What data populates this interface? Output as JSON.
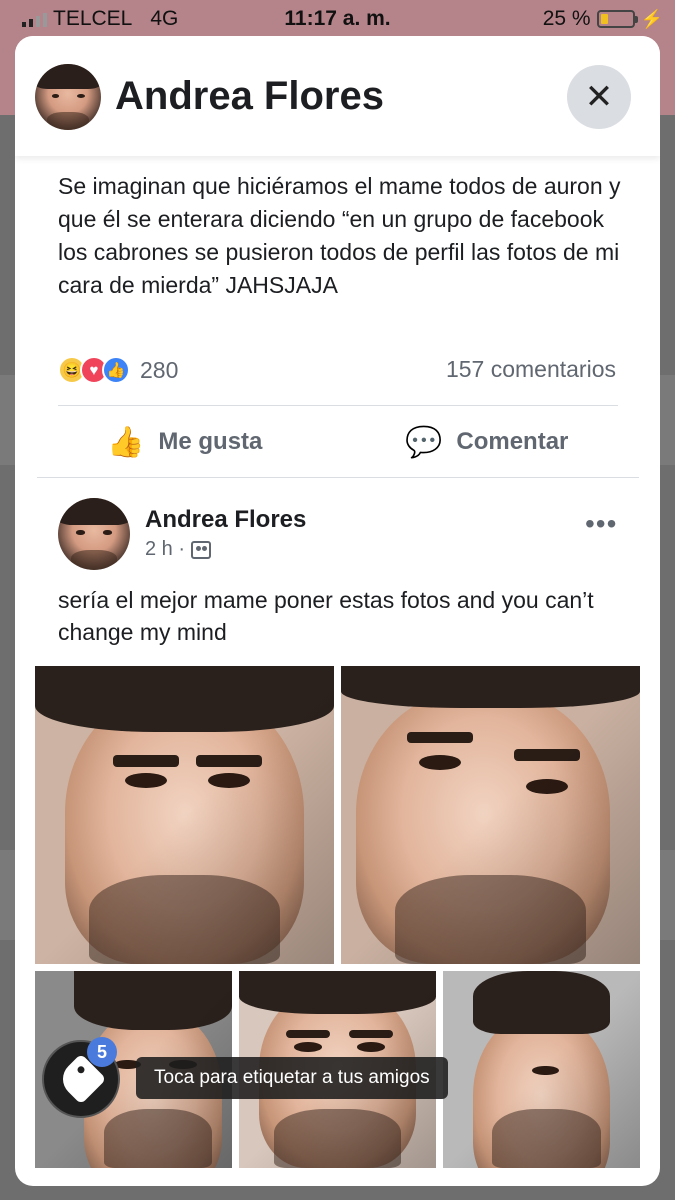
{
  "status_bar": {
    "carrier": "TELCEL",
    "network": "4G",
    "time": "11:17 a. m.",
    "battery_percent": "25 %",
    "battery_level": 0.25
  },
  "header": {
    "name": "Andrea Flores",
    "close_icon": "close-icon"
  },
  "post1": {
    "text": "Se imaginan que hiciéramos el mame todos de auron y que él se enterara diciendo “en un grupo de facebook los cabrones se pusieron todos de perfil las fotos de mi cara de mierda” JAHSJAJA",
    "reactions": {
      "icons": [
        "haha-icon",
        "love-icon",
        "like-icon"
      ],
      "count": "280"
    },
    "comments": "157 comentarios",
    "actions": {
      "like_label": "Me gusta",
      "comment_label": "Comentar"
    }
  },
  "post2": {
    "author": "Andrea Flores",
    "time": "2 h ·",
    "more": "•••",
    "text": "sería el mejor mame poner estas fotos and you can’t change my mind",
    "photo_count": 5
  },
  "tagging": {
    "badge": "5",
    "tooltip": "Toca para etiquetar a tus amigos"
  },
  "colors": {
    "accent": "#4a7bdc",
    "background_band": "#b5848a",
    "secondary_text": "#606770"
  }
}
